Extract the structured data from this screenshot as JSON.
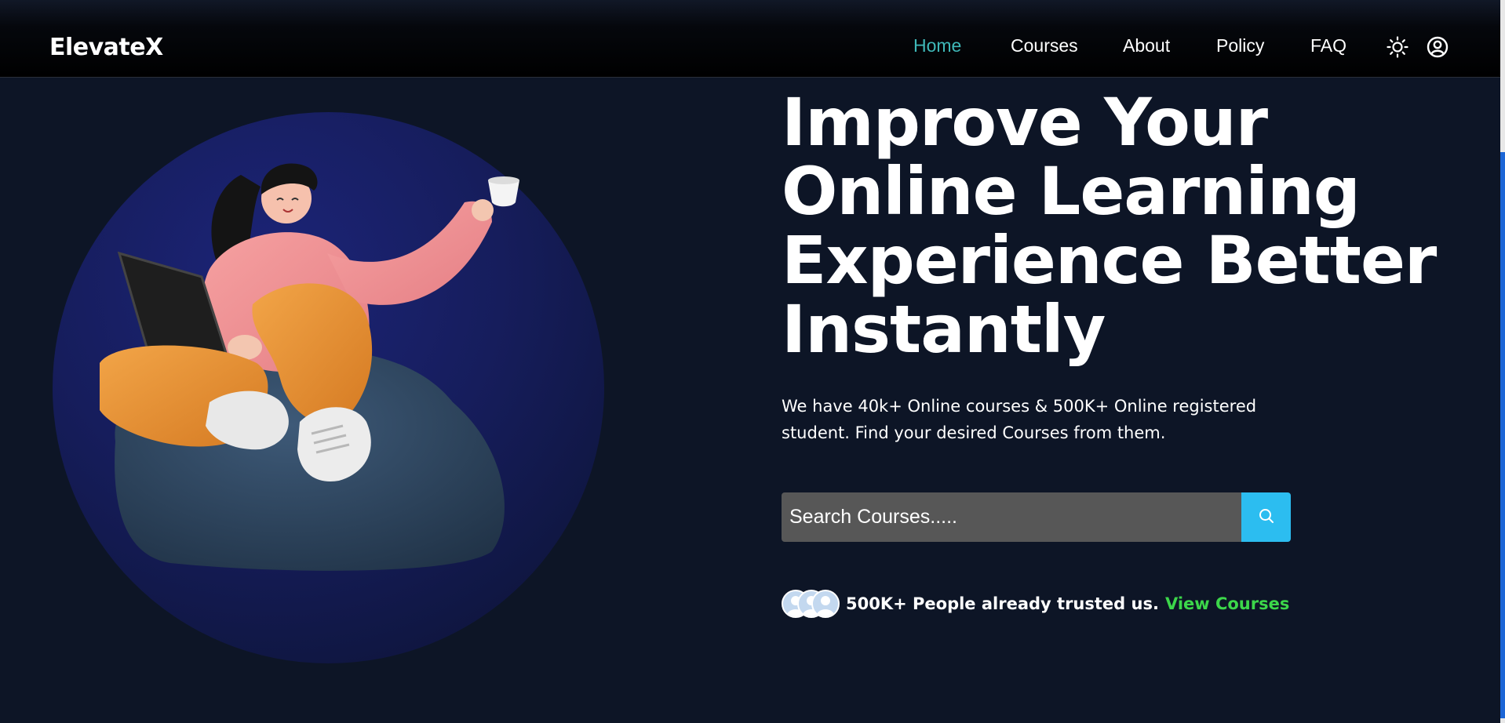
{
  "brand": {
    "name": "ElevateX"
  },
  "nav": {
    "links": [
      {
        "label": "Home",
        "active": true
      },
      {
        "label": "Courses",
        "active": false
      },
      {
        "label": "About",
        "active": false
      },
      {
        "label": "Policy",
        "active": false
      },
      {
        "label": "FAQ",
        "active": false
      }
    ],
    "icons": [
      "sun-icon",
      "user-circle-icon"
    ]
  },
  "hero": {
    "title_lines": [
      "Improve Your",
      "Online Learning",
      "Experience Better",
      "Instantly"
    ],
    "subtitle": "We have 40k+ Online courses & 500K+ Online registered student. Find your desired Courses from them.",
    "illustration": "woman-with-laptop-on-beanbag"
  },
  "search": {
    "placeholder": "Search Courses.....",
    "value": "",
    "button_icon": "search-icon"
  },
  "trust": {
    "text": "500K+ People already trusted us.",
    "link": "View Courses",
    "avatar_icons": [
      "user-icon",
      "user-icon",
      "user-icon"
    ]
  },
  "colors": {
    "background": "#0d1526",
    "nav_active": "#3fb8b8",
    "search_button": "#2cbdf0",
    "link_green": "#3cd74a",
    "search_field": "#575757"
  }
}
